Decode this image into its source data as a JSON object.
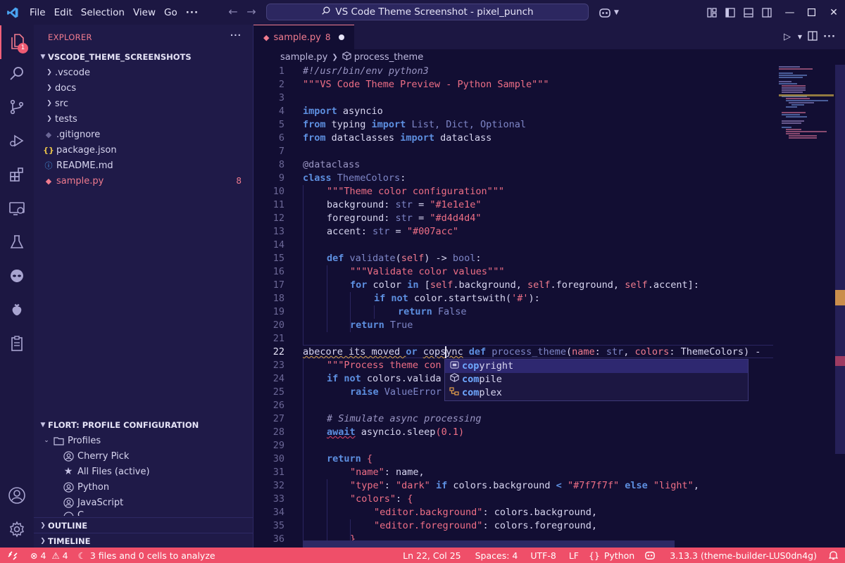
{
  "titlebar": {
    "menu": [
      "File",
      "Edit",
      "Selection",
      "View",
      "Go",
      "···"
    ],
    "command_center": "VS Code Theme Screenshot - pixel_punch"
  },
  "activity": {
    "explorer_badge": "1"
  },
  "explorer": {
    "title": "EXPLORER",
    "more": "···",
    "root": "VSCODE_THEME_SCREENSHOTS",
    "items": [
      {
        "label": ".vscode",
        "kind": "folder"
      },
      {
        "label": "docs",
        "kind": "folder"
      },
      {
        "label": "src",
        "kind": "folder"
      },
      {
        "label": "tests",
        "kind": "folder"
      },
      {
        "label": ".gitignore",
        "kind": "gitignore"
      },
      {
        "label": "package.json",
        "kind": "json"
      },
      {
        "label": "README.md",
        "kind": "info"
      },
      {
        "label": "sample.py",
        "kind": "python",
        "count": "8"
      }
    ]
  },
  "flort": {
    "title": "FLORT: PROFILE CONFIGURATION",
    "group": "Profiles",
    "profiles": [
      "Cherry Pick",
      "All Files (active)",
      "Python",
      "JavaScript",
      "C"
    ]
  },
  "panels": {
    "outline": "OUTLINE",
    "timeline": "TIMELINE"
  },
  "tab": {
    "label": "sample.py",
    "count": "8"
  },
  "breadcrumb": {
    "file": "sample.py",
    "symbol": "process_theme"
  },
  "editor": {
    "line_numbers": [
      "1",
      "2",
      "3",
      "4",
      "5",
      "6",
      "7",
      "8",
      "9",
      "10",
      "11",
      "12",
      "13",
      "14",
      "15",
      "16",
      "17",
      "18",
      "19",
      "20",
      "21",
      "22",
      "23",
      "24",
      "25",
      "26",
      "27",
      "28",
      "29",
      "30",
      "31",
      "32",
      "33",
      "34",
      "35",
      "36"
    ],
    "tokens": {
      "l1": "#!/usr/bin/env python3",
      "l2": "\"\"\"VS Code Theme Preview - Python Sample\"\"\"",
      "kw_import": "import",
      "kw_from": "from",
      "l4b": " asyncio",
      "l5b": " typing ",
      "l5d": " List, Dict, Optional",
      "l6b": " dataclasses ",
      "l6d": " dataclass",
      "l8": "@dataclass",
      "kw_class": "class",
      "l9b": " ",
      "l9c": "ThemeColors",
      "l9d": ":",
      "l10": "\"\"\"Theme color configuration\"\"\"",
      "l11a": "background: ",
      "l11b": "str",
      "l11c": " = ",
      "l11d": "\"#1e1e1e\"",
      "l12a": "foreground: ",
      "l12b": "str",
      "l12c": " = ",
      "l12d": "\"#d4d4d4\"",
      "l13a": "accent: ",
      "l13b": "str",
      "l13c": " = ",
      "l13d": "\"#007acc\"",
      "kw_def": "def",
      "l15b": " ",
      "l15c": "validate",
      "l15d": "(",
      "l15e": "self",
      "l15f": ") -> ",
      "l15g": "bool",
      "l15h": ":",
      "l16": "\"\"\"Validate color values\"\"\"",
      "kw_for": "for",
      "l17b": " color ",
      "kw_in": "in",
      "l17d": " [",
      "kw_self": "self",
      "l17f": ".background, ",
      "l17h": ".foreground, ",
      "l17j": ".accent]:",
      "kw_if": "if",
      "kw_not": "not",
      "l18b": " ",
      "l18c": " color.startswith(",
      "l18d": "'#'",
      "l18e": "):",
      "kw_return": "return",
      "l19b": " ",
      "l19c": "False",
      "l20c": "True",
      "l22a": "abecore its moved ",
      "kw_or": "or",
      "l22b": " ",
      "l22c": "copsync",
      "l22d": " ",
      "l22f": " ",
      "l22g": "process_theme",
      "l22h": "(",
      "l22i": "name",
      "l22j": ": ",
      "l22k": "str",
      "l22l": ", ",
      "l22m": "colors",
      "l22n": ": ThemeColors) -",
      "l23": "\"\"\"Process theme con",
      "l24b": " colors.valida",
      "kw_raise": "raise",
      "l25b": " ",
      "l25c": "ValueError",
      "l27": "# Simulate async processing",
      "kw_await": "await",
      "l28b": " asyncio.sleep",
      "l28c": "(",
      "l28d": "0.1",
      "l28e": ")",
      "l30b": " ",
      "l30c": "{",
      "l31a": "\"name\"",
      "l31b": ": name,",
      "l32a": "\"type\"",
      "l32b": ": ",
      "l32c": "\"dark\"",
      "l32d": " ",
      "l32e": " colors.background ",
      "l32f": "<",
      "l32g": " ",
      "l32h": "\"#7f7f7f\"",
      "l32i": " ",
      "kw_else": "else",
      "l32j": " ",
      "l32k": "\"light\"",
      "l32l": ",",
      "l33a": "\"colors\"",
      "l33b": ": ",
      "l33c": "{",
      "l34a": "\"editor.background\"",
      "l34b": ": colors.background,",
      "l35a": "\"editor.foreground\"",
      "l35b": ": colors.foreground,",
      "l36": "}"
    }
  },
  "suggestions": [
    {
      "match": "cop",
      "rest": "yright",
      "icon": "variable-icon"
    },
    {
      "match": "com",
      "rest": "pile",
      "icon": "method-icon"
    },
    {
      "match": "com",
      "rest": "plex",
      "icon": "class-icon"
    }
  ],
  "status": {
    "errors": "4",
    "warnings": "4",
    "analyze": "3 files and 0 cells to analyze",
    "position": "Ln 22, Col 25",
    "spaces": "Spaces: 4",
    "encoding": "UTF-8",
    "eol": "LF",
    "language": "Python",
    "interpreter": "3.13.3 (theme-builder-LUS0dn4g)"
  },
  "colors": {
    "accent": "#ef4f69",
    "background": "#120e33",
    "sidebar": "#1f1a48"
  }
}
